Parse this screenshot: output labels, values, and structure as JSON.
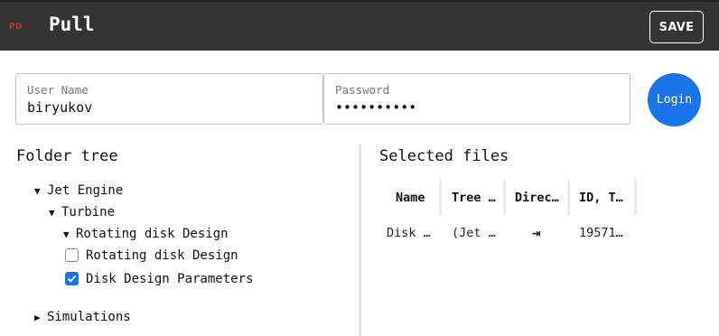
{
  "app": {
    "logo_text": "PD",
    "logo_text2": "Tec",
    "title": "Pull",
    "save_label": "SAVE"
  },
  "login": {
    "username_label": "User Name",
    "username_value": "biryukov",
    "password_label": "Password",
    "password_value": "••••••••••",
    "login_label": "Login"
  },
  "folder_tree": {
    "title": "Folder tree",
    "items": [
      {
        "label": "Jet Engine",
        "expanded": true
      },
      {
        "label": "Turbine",
        "expanded": true
      },
      {
        "label": "Rotating disk Design",
        "expanded": true
      },
      {
        "label": "Rotating disk Design",
        "checked": false
      },
      {
        "label": "Disk Design Parameters",
        "checked": true
      },
      {
        "label": "Simulations",
        "expanded": false
      }
    ]
  },
  "selected_files": {
    "title": "Selected files",
    "columns": [
      "Name",
      "Tree …",
      "Direc…",
      "ID, T…"
    ],
    "rows": [
      {
        "name": "Disk …",
        "tree": "(Jet …",
        "direction": "⇥",
        "id": "19571…"
      }
    ]
  },
  "colors": {
    "appbar": "#333333",
    "accent": "#1a73e8"
  }
}
